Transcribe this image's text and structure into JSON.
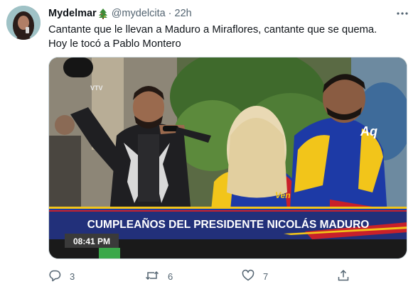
{
  "tweet": {
    "author_name": "Mydelmar",
    "author_handle": "@mydelcita",
    "separator": "·",
    "time": "22h",
    "text_line1": "Cantante que le llevan a Maduro a Miraflores, cantante que se quema.",
    "text_line2": "Hoy le tocó a Pablo Montero",
    "media": {
      "banner": "CUMPLEAÑOS DEL PRESIDENTE NICOLÁS MADURO",
      "clock": "08:41 PM",
      "jacket_text": "Aq",
      "shirt_text": "Ven"
    },
    "actions": {
      "replies": "3",
      "retweets": "6",
      "likes": "7"
    }
  },
  "colors": {
    "text_primary": "#0f1419",
    "text_secondary": "#536471",
    "banner_blue": "#22307a",
    "venezuela_yellow": "#f2c51a",
    "venezuela_blue": "#1d3aa6",
    "venezuela_red": "#c8202a"
  },
  "icons": [
    "christmas-tree-icon",
    "more-icon",
    "reply-icon",
    "retweet-icon",
    "like-icon",
    "share-icon"
  ]
}
